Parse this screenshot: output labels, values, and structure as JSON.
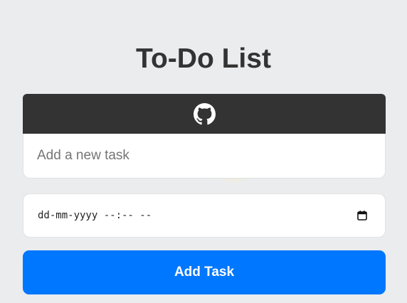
{
  "header": {
    "title": "To-Do List"
  },
  "github": {
    "icon": "github-icon",
    "background": "#333333"
  },
  "task_input": {
    "value": "",
    "placeholder": "Add a new task"
  },
  "datetime_input": {
    "display": "dd-mm-yyyy --:-- --",
    "icon": "calendar-icon"
  },
  "add_button": {
    "label": "Add Task",
    "background": "#0077ff"
  },
  "colors": {
    "page_background": "#ebecee",
    "title_text": "#333333"
  }
}
